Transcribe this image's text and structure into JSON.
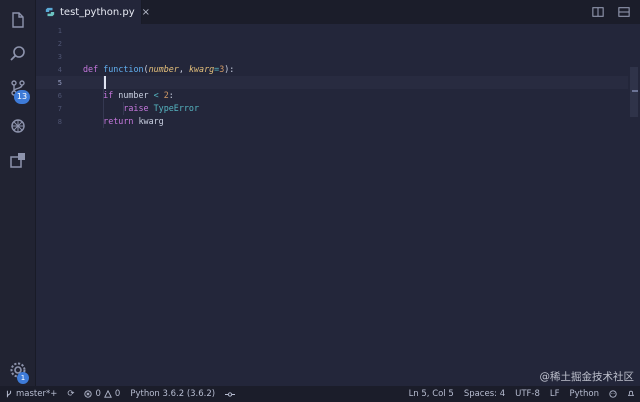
{
  "tab": {
    "filename": "test_python.py",
    "close_glyph": "×"
  },
  "icons": {
    "explorer": "files-icon",
    "search": "search-icon",
    "scm": "source-control-icon",
    "debug": "debug-icon",
    "extensions": "extensions-icon",
    "settings": "gear-icon",
    "split": "split-editor-icon",
    "more": "more-icon"
  },
  "badges": {
    "scm_count": "13",
    "settings_count": "1"
  },
  "editor": {
    "line_numbers": [
      "1",
      "2",
      "3",
      "4",
      "5",
      "6",
      "7",
      "8"
    ],
    "active_line": 5,
    "lines": [
      {
        "number": "1",
        "tokens": []
      },
      {
        "number": "2",
        "tokens": []
      },
      {
        "number": "3",
        "tokens": []
      },
      {
        "number": "4",
        "tokens": [
          {
            "t": "def",
            "c": "kw"
          },
          {
            "t": " ",
            "c": "plain"
          },
          {
            "t": "function",
            "c": "fn"
          },
          {
            "t": "(",
            "c": "plain"
          },
          {
            "t": "number",
            "c": "param"
          },
          {
            "t": ", ",
            "c": "plain"
          },
          {
            "t": "kwarg",
            "c": "param"
          },
          {
            "t": "=",
            "c": "op"
          },
          {
            "t": "3",
            "c": "num"
          },
          {
            "t": "):",
            "c": "plain"
          }
        ]
      },
      {
        "number": "5",
        "tokens": []
      },
      {
        "number": "6",
        "tokens": [
          {
            "t": "    ",
            "c": "plain"
          },
          {
            "t": "if",
            "c": "kw"
          },
          {
            "t": " number ",
            "c": "plain"
          },
          {
            "t": "<",
            "c": "op"
          },
          {
            "t": " ",
            "c": "plain"
          },
          {
            "t": "2",
            "c": "num"
          },
          {
            "t": ":",
            "c": "plain"
          }
        ]
      },
      {
        "number": "7",
        "tokens": [
          {
            "t": "        ",
            "c": "plain"
          },
          {
            "t": "raise",
            "c": "kw"
          },
          {
            "t": " ",
            "c": "plain"
          },
          {
            "t": "TypeError",
            "c": "cls"
          }
        ]
      },
      {
        "number": "8",
        "tokens": [
          {
            "t": "    ",
            "c": "plain"
          },
          {
            "t": "return",
            "c": "kw"
          },
          {
            "t": " kwarg",
            "c": "plain"
          }
        ]
      }
    ]
  },
  "status": {
    "branch": "master*+",
    "sync_glyph": "⟳",
    "errors": "0",
    "warnings": "0",
    "interpreter": "Python 3.6.2 (3.6.2)",
    "cursor_pos": "Ln 5, Col 5",
    "indent": "Spaces: 4",
    "encoding": "UTF-8",
    "eol": "LF",
    "language": "Python"
  },
  "watermark": "@稀土掘金技术社区",
  "colors": {
    "accent": "#3e7bd8",
    "keyword": "#c678dd",
    "function": "#61afef"
  }
}
